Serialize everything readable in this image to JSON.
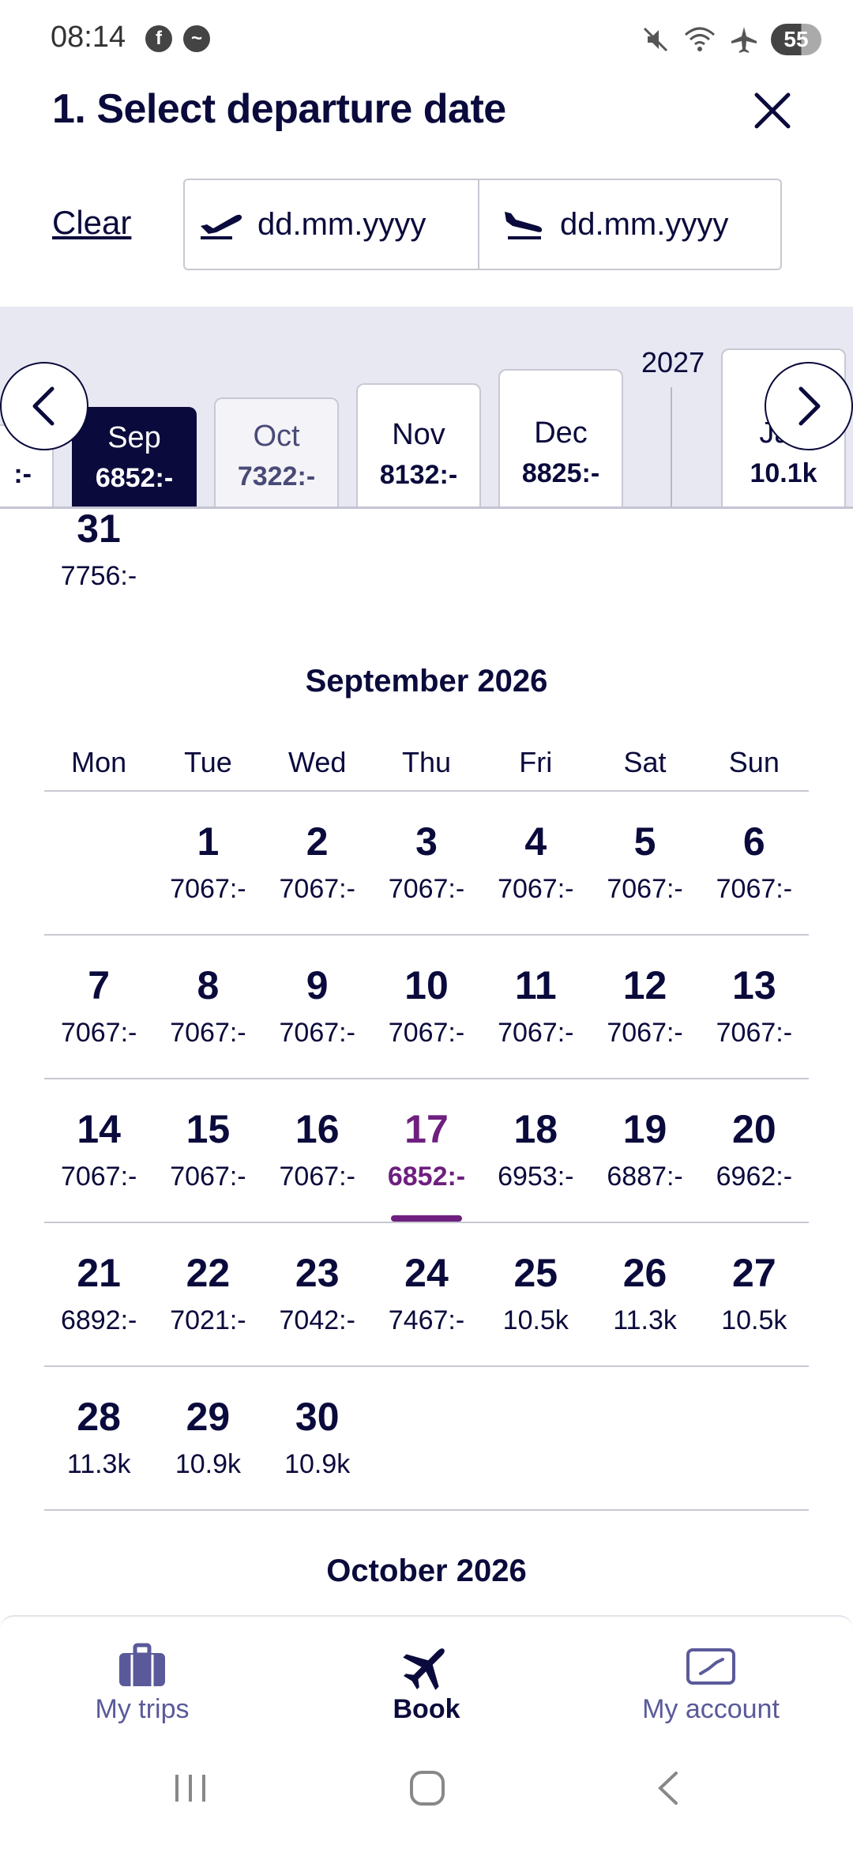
{
  "status_bar": {
    "time": "08:14",
    "left_icons": [
      "facebook-icon",
      "messenger-icon"
    ],
    "right_icons": [
      "mute-icon",
      "wifi-icon",
      "airplane-icon"
    ],
    "battery": "55"
  },
  "header": {
    "title": "1. Select departure date",
    "close_icon": "close-icon"
  },
  "date_inputs": {
    "clear_label": "Clear",
    "departure_placeholder": "dd.mm.yyyy",
    "return_placeholder": "dd.mm.yyyy"
  },
  "month_strip": {
    "partial_left_price": ":-",
    "months": [
      {
        "name": "Sep",
        "price": "6852:-",
        "state": "selected"
      },
      {
        "name": "Oct",
        "price": "7322:-",
        "state": "dim"
      },
      {
        "name": "Nov",
        "price": "8132:-",
        "state": "normal"
      },
      {
        "name": "Dec",
        "price": "8825:-",
        "state": "normal"
      },
      {
        "name": "Jan",
        "price": "10.1k",
        "state": "normal"
      }
    ],
    "year_label": "2027"
  },
  "previous_month_tail": {
    "day": "31",
    "price": "7756:-"
  },
  "calendar": {
    "title": "September 2026",
    "weekdays": [
      "Mon",
      "Tue",
      "Wed",
      "Thu",
      "Fri",
      "Sat",
      "Sun"
    ],
    "weeks": [
      [
        null,
        {
          "d": "1",
          "p": "7067:-"
        },
        {
          "d": "2",
          "p": "7067:-"
        },
        {
          "d": "3",
          "p": "7067:-"
        },
        {
          "d": "4",
          "p": "7067:-"
        },
        {
          "d": "5",
          "p": "7067:-"
        },
        {
          "d": "6",
          "p": "7067:-"
        }
      ],
      [
        {
          "d": "7",
          "p": "7067:-"
        },
        {
          "d": "8",
          "p": "7067:-"
        },
        {
          "d": "9",
          "p": "7067:-"
        },
        {
          "d": "10",
          "p": "7067:-"
        },
        {
          "d": "11",
          "p": "7067:-"
        },
        {
          "d": "12",
          "p": "7067:-"
        },
        {
          "d": "13",
          "p": "7067:-"
        }
      ],
      [
        {
          "d": "14",
          "p": "7067:-"
        },
        {
          "d": "15",
          "p": "7067:-"
        },
        {
          "d": "16",
          "p": "7067:-"
        },
        {
          "d": "17",
          "p": "6852:-",
          "selected": true
        },
        {
          "d": "18",
          "p": "6953:-"
        },
        {
          "d": "19",
          "p": "6887:-"
        },
        {
          "d": "20",
          "p": "6962:-"
        }
      ],
      [
        {
          "d": "21",
          "p": "6892:-"
        },
        {
          "d": "22",
          "p": "7021:-"
        },
        {
          "d": "23",
          "p": "7042:-"
        },
        {
          "d": "24",
          "p": "7467:-"
        },
        {
          "d": "25",
          "p": "10.5k"
        },
        {
          "d": "26",
          "p": "11.3k"
        },
        {
          "d": "27",
          "p": "10.5k"
        }
      ],
      [
        {
          "d": "28",
          "p": "11.3k"
        },
        {
          "d": "29",
          "p": "10.9k"
        },
        {
          "d": "30",
          "p": "10.9k"
        },
        null,
        null,
        null,
        null
      ]
    ]
  },
  "next_calendar_title": "October 2026",
  "bottom_nav": [
    {
      "label": "My trips",
      "icon": "suitcase-icon",
      "active": false
    },
    {
      "label": "Book",
      "icon": "airplane-icon",
      "active": true
    },
    {
      "label": "My account",
      "icon": "card-icon",
      "active": false
    }
  ],
  "system_nav": [
    "recents-icon",
    "home-icon",
    "back-icon"
  ],
  "colors": {
    "primary": "#0a0a3c",
    "accent": "#6e1f7f",
    "strip_bg": "#e8e8f2",
    "nav_muted": "#5a5a9a"
  }
}
